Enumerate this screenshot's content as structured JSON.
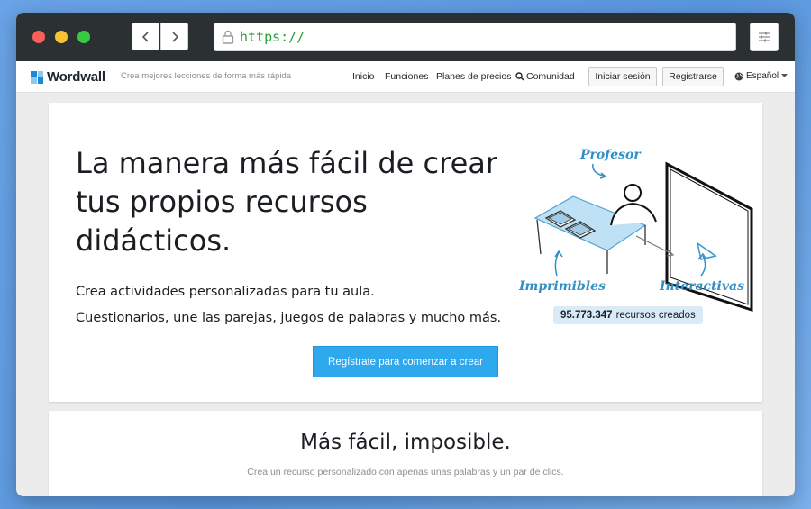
{
  "browser": {
    "url": "https://",
    "icons": {
      "back": "chevron-left-icon",
      "forward": "chevron-right-icon",
      "lock": "lock-icon",
      "settings": "sliders-icon"
    }
  },
  "site": {
    "logo_text": "Wordwall",
    "tagline": "Crea mejores lecciones de forma más rápida",
    "nav": {
      "home": "Inicio",
      "features": "Funciones",
      "pricing": "Planes de precios",
      "community": "Comunidad"
    },
    "login_label": "Iniciar sesión",
    "register_label": "Registrarse",
    "language": "Español"
  },
  "hero": {
    "headline": "La manera más fácil de crear tus propios recursos didácticos.",
    "subtitle_1": "Crea actividades personalizadas para tu aula.",
    "subtitle_2": "Cuestionarios, une las parejas, juegos de palabras y mucho más.",
    "cta_label": "Regístrate para comenzar a crear",
    "illustration": {
      "teacher_label": "Profesor",
      "printables_label": "Imprimibles",
      "interactive_label": "Interactivas"
    },
    "counter_value": "95.773.347",
    "counter_label": "recursos creados"
  },
  "section2": {
    "title": "Más fácil, imposible.",
    "subtitle": "Crea un recurso personalizado con apenas unas palabras y un par de clics."
  },
  "colors": {
    "accent": "#2fa9ed",
    "url_text": "#2aa038",
    "titlebar": "#2b3033"
  }
}
